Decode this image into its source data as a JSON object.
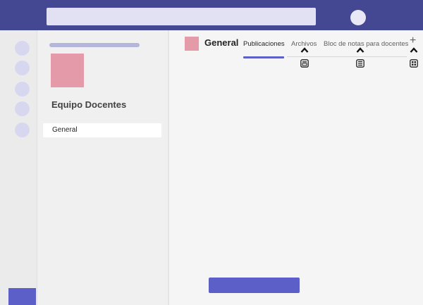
{
  "team": {
    "name": "Equipo Docentes",
    "channels": [
      "General"
    ]
  },
  "channel": {
    "title": "General",
    "tabs": [
      "Publicaciones",
      "Archivos",
      "Bloc de notas para docentes"
    ],
    "active_tab": "Publicaciones",
    "add_tab_label": "+"
  },
  "colors": {
    "brand": "#444791",
    "accent": "#5b5fc7",
    "team_tile": "#e59aa9"
  },
  "icons": [
    "chevron-up-icon",
    "files-tab-icon",
    "notebook-tab-icon",
    "app-tab-icon",
    "add-tab-icon"
  ]
}
